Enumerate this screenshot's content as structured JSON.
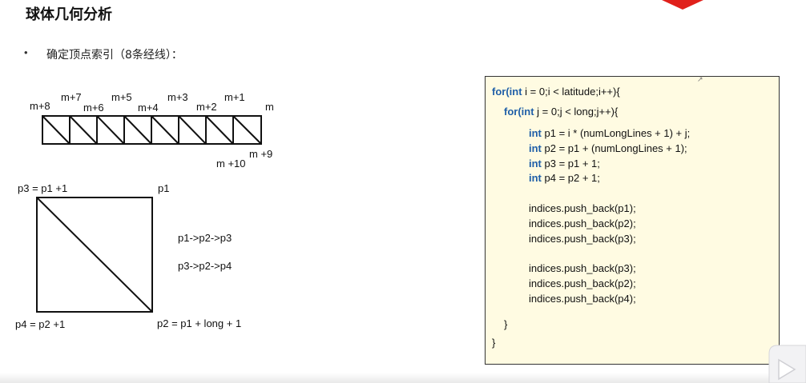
{
  "slide": {
    "title": "球体几何分析",
    "bullet": "确定顶点索引（8条经线）："
  },
  "strip_labels": {
    "m8": "m+8",
    "m7": "m+7",
    "m6": "m+6",
    "m5": "m+5",
    "m4": "m+4",
    "m3": "m+3",
    "m2": "m+2",
    "m1": "m+1",
    "m": "m",
    "m9": "m +9",
    "m10": "m +10"
  },
  "quad_labels": {
    "p3": "p3 = p1 +1",
    "p1": "p1",
    "p4": "p4 = p2 +1",
    "p2": "p2 = p1 + long + 1",
    "tri1": "p1->p2->p3",
    "tri2": "p3->p2->p4"
  },
  "code": {
    "l1_kw1": "for(",
    "l1_kw2": "int",
    "l1_rest": " i = 0;i < latitude;i++){",
    "l2_kw1": "for(",
    "l2_kw2": "int",
    "l2_rest": " j = 0;j < long;j++){",
    "l3_kw": "int",
    "l3_rest": " p1 = i * (numLongLines + 1) + j;",
    "l4_kw": "int",
    "l4_rest": " p2 = p1 + (numLongLines + 1);",
    "l5_kw": "int",
    "l5_rest": " p3 = p1 + 1;",
    "l6_kw": "int",
    "l6_rest": " p4 = p2 + 1;",
    "l7": "indices.push_back(p1);",
    "l8": "indices.push_back(p2);",
    "l9": "indices.push_back(p3);",
    "l10": "indices.push_back(p3);",
    "l11": "indices.push_back(p2);",
    "l12": "indices.push_back(p4);",
    "l13": "}",
    "l14": "}"
  },
  "colors": {
    "keyword": "#1f5fa8",
    "code_background": "#fffbe2",
    "accent_red": "#e0201b"
  },
  "icons": {
    "cursor": "cursor-arrow-icon",
    "corner": "play-corner-icon"
  }
}
